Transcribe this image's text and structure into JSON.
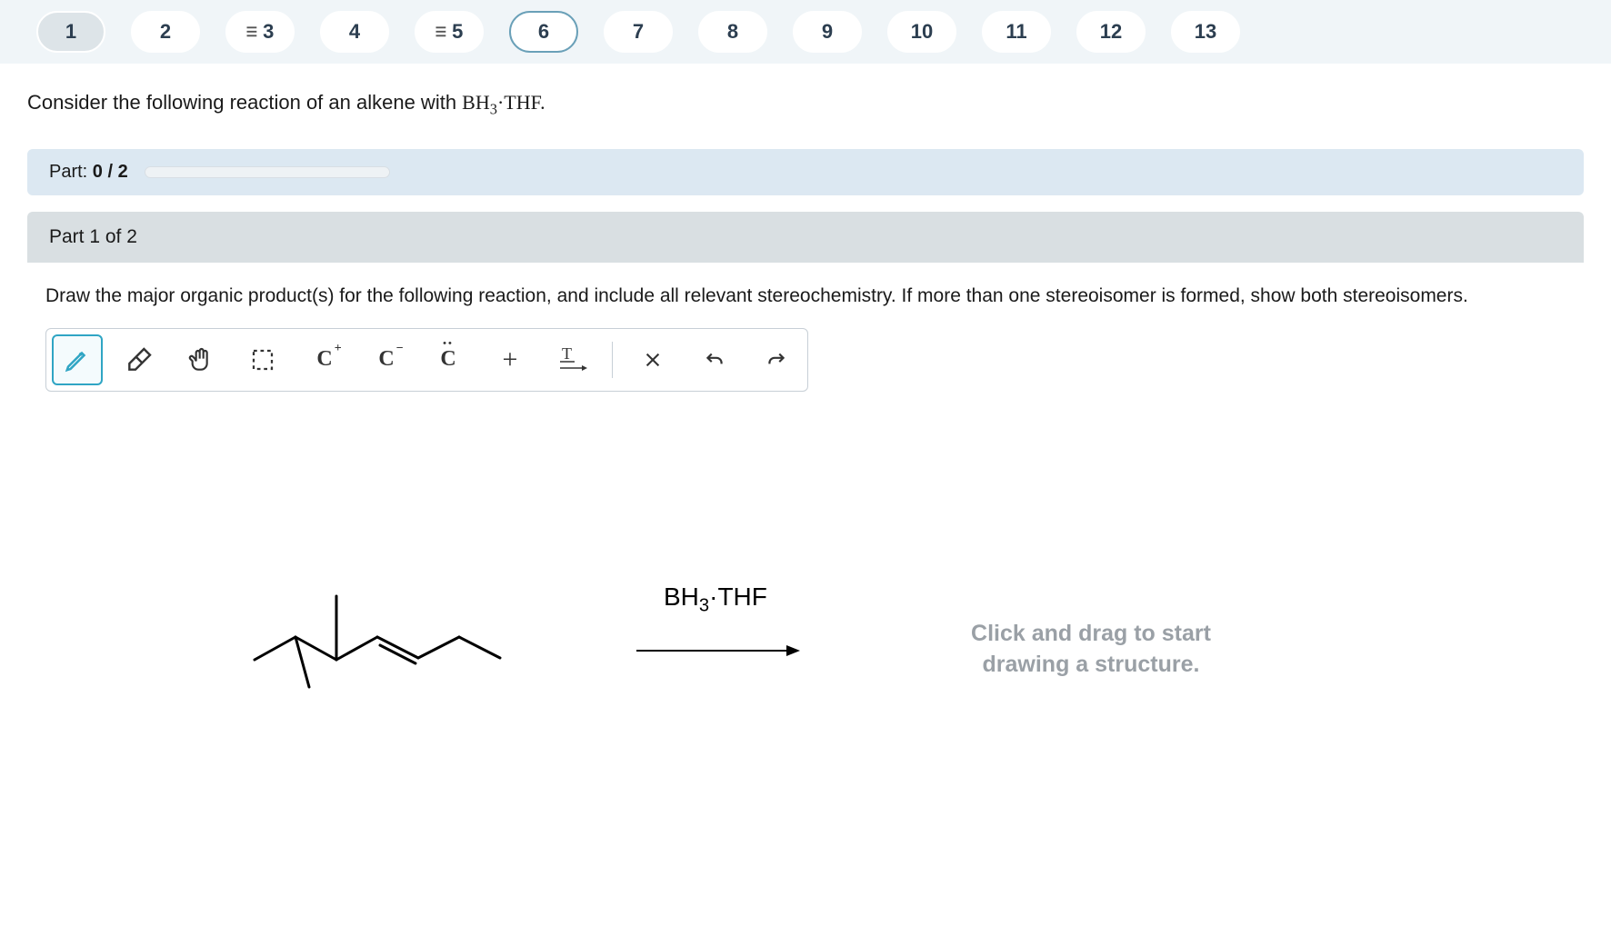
{
  "nav": {
    "items": [
      {
        "label": "1",
        "hamburger": false,
        "state": "current"
      },
      {
        "label": "2",
        "hamburger": false,
        "state": "normal"
      },
      {
        "label": "3",
        "hamburger": true,
        "state": "normal"
      },
      {
        "label": "4",
        "hamburger": false,
        "state": "normal"
      },
      {
        "label": "5",
        "hamburger": true,
        "state": "normal"
      },
      {
        "label": "6",
        "hamburger": false,
        "state": "outlined"
      },
      {
        "label": "7",
        "hamburger": false,
        "state": "normal"
      },
      {
        "label": "8",
        "hamburger": false,
        "state": "normal"
      },
      {
        "label": "9",
        "hamburger": false,
        "state": "normal"
      },
      {
        "label": "10",
        "hamburger": false,
        "state": "normal"
      },
      {
        "label": "11",
        "hamburger": false,
        "state": "normal"
      },
      {
        "label": "12",
        "hamburger": false,
        "state": "normal"
      },
      {
        "label": "13",
        "hamburger": false,
        "state": "normal"
      }
    ]
  },
  "intro": {
    "prefix": "Consider the following reaction of an alkene with ",
    "reagent_main": "BH",
    "reagent_sub": "3",
    "reagent_suffix": "·THF."
  },
  "progress": {
    "label_prefix": "Part: ",
    "value": "0 / 2"
  },
  "part": {
    "header": "Part 1 of 2",
    "instructions": "Draw the major organic product(s) for the following reaction, and include all relevant stereochemistry. If more than one stereoisomer is formed, show both stereoisomers."
  },
  "toolbar": {
    "tools": [
      {
        "name": "pencil-icon",
        "active": true
      },
      {
        "name": "eraser-icon",
        "active": false
      },
      {
        "name": "hand-icon",
        "active": false
      },
      {
        "name": "marquee-icon",
        "active": false
      },
      {
        "name": "charge-plus-icon",
        "active": false
      },
      {
        "name": "charge-minus-icon",
        "active": false
      },
      {
        "name": "lone-pair-icon",
        "active": false
      },
      {
        "name": "plus-icon",
        "active": false
      },
      {
        "name": "text-arrow-icon",
        "active": false
      }
    ],
    "actions": [
      {
        "name": "close-icon"
      },
      {
        "name": "undo-icon"
      },
      {
        "name": "redo-icon"
      }
    ]
  },
  "canvas": {
    "reagent_main": "BH",
    "reagent_sub": "3",
    "reagent_suffix": "·THF",
    "placeholder_line1": "Click and drag to start",
    "placeholder_line2": "drawing a structure."
  }
}
